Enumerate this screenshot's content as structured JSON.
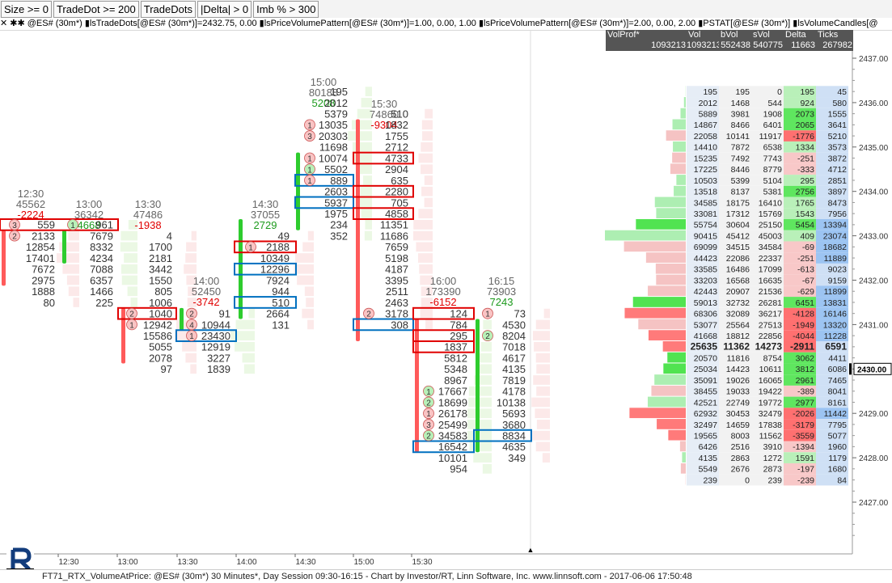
{
  "toolbar": {
    "items": [
      "Size >= 0",
      "TradeDot >= 200",
      "TradeDots",
      "|Delta| > 0",
      "Imb % > 300"
    ]
  },
  "title": "✕  ✱✱ @ES# (30m*) ▮lsTradeDots[@ES# (30m*)]=2432.75, 0.00 ▮lsPriceVolumePattern[@ES# (30m*)]=1.00, 0.00, 1.00 ▮lsPriceVolumePattern[@ES# (30m*)]=2.00, 0.00, 2.00 ▮PSTAT[@ES# (30m*)] ▮lsVolumeCandles[@",
  "footer": "FT71_RTX_VolumeAtPrice: @ES# (30m*) 30 Minutes*, Day Session 09:30-16:15 - Chart by Investor/RT, Linn Software, Inc. www.linnsoft.com - 2017-06-06 17:50:48",
  "volume_profile": {
    "summary_headers": [
      "VolProf*",
      "Vol",
      "bVol",
      "sVol",
      "Delta",
      "Ticks"
    ],
    "summary_values": [
      "1093213",
      "1093213",
      "552438",
      "540775",
      "11663",
      "267982"
    ],
    "rows": [
      {
        "price": 2436.25,
        "vp": 195,
        "vol": 195,
        "bvol": 0,
        "svol": 195,
        "delta": 195,
        "ticks": 45
      },
      {
        "price": 2436.0,
        "vp": 2012,
        "vol": 1468,
        "bvol": 544,
        "svol": 924,
        "delta": 924,
        "ticks": 580
      },
      {
        "price": 2435.75,
        "vp": 5889,
        "vol": 3981,
        "bvol": 1908,
        "svol": 2073,
        "delta": 2073,
        "ticks": 1555
      },
      {
        "price": 2435.5,
        "vp": 14867,
        "vol": 8466,
        "bvol": 6401,
        "svol": 2065,
        "delta": 2065,
        "ticks": 3641
      },
      {
        "price": 2435.25,
        "vp": 22058,
        "vol": 10141,
        "bvol": 11917,
        "svol": -1776,
        "delta": -1776,
        "ticks": 5210
      },
      {
        "price": 2435.0,
        "vp": 14410,
        "vol": 7872,
        "bvol": 6538,
        "svol": 1334,
        "delta": 1334,
        "ticks": 3573
      },
      {
        "price": 2434.75,
        "vp": 15235,
        "vol": 7492,
        "bvol": 7743,
        "svol": -251,
        "delta": -251,
        "ticks": 3872
      },
      {
        "price": 2434.5,
        "vp": 17225,
        "vol": 8446,
        "bvol": 8779,
        "svol": -333,
        "delta": -333,
        "ticks": 4712
      },
      {
        "price": 2434.25,
        "vp": 10503,
        "vol": 5399,
        "bvol": 5104,
        "svol": 295,
        "delta": 295,
        "ticks": 2851
      },
      {
        "price": 2434.0,
        "vp": 13518,
        "vol": 8137,
        "bvol": 5381,
        "svol": 2756,
        "delta": 2756,
        "ticks": 3897
      },
      {
        "price": 2433.75,
        "vp": 34585,
        "vol": 18175,
        "bvol": 16410,
        "svol": 1765,
        "delta": 1765,
        "ticks": 8473
      },
      {
        "price": 2433.5,
        "vp": 33081,
        "vol": 17312,
        "bvol": 15769,
        "svol": 1543,
        "delta": 1543,
        "ticks": 7956
      },
      {
        "price": 2433.25,
        "vp": 55754,
        "vol": 30604,
        "bvol": 25150,
        "svol": 5454,
        "delta": 5454,
        "ticks": 13394
      },
      {
        "price": 2433.0,
        "vp": 90415,
        "vol": 45412,
        "bvol": 45003,
        "svol": 409,
        "delta": 409,
        "ticks": 23074
      },
      {
        "price": 2432.75,
        "vp": 69099,
        "vol": 34515,
        "bvol": 34584,
        "svol": -69,
        "delta": -69,
        "ticks": 18682
      },
      {
        "price": 2432.5,
        "vp": 44423,
        "vol": 22086,
        "bvol": 22337,
        "svol": -251,
        "delta": -251,
        "ticks": 11889
      },
      {
        "price": 2432.25,
        "vp": 33585,
        "vol": 16486,
        "bvol": 17099,
        "svol": -613,
        "delta": -613,
        "ticks": 9023
      },
      {
        "price": 2432.0,
        "vp": 33203,
        "vol": 16568,
        "bvol": 16635,
        "svol": -67,
        "delta": -67,
        "ticks": 9159
      },
      {
        "price": 2431.75,
        "vp": 42443,
        "vol": 20907,
        "bvol": 21536,
        "svol": -629,
        "delta": -629,
        "ticks": 11899
      },
      {
        "price": 2431.5,
        "vp": 59013,
        "vol": 32732,
        "bvol": 26281,
        "svol": 6451,
        "delta": 6451,
        "ticks": 13831
      },
      {
        "price": 2431.25,
        "vp": 68306,
        "vol": 32089,
        "bvol": 36217,
        "svol": -4128,
        "delta": -4128,
        "ticks": 16146
      },
      {
        "price": 2431.0,
        "vp": 53077,
        "vol": 25564,
        "bvol": 27513,
        "svol": -1949,
        "delta": -1949,
        "ticks": 13320
      },
      {
        "price": 2430.75,
        "vp": 41668,
        "vol": 18812,
        "bvol": 22856,
        "svol": -4044,
        "delta": -4044,
        "ticks": 11228
      },
      {
        "price": 2430.5,
        "vp": 25635,
        "vol": 11362,
        "bvol": 14273,
        "svol": -2911,
        "delta": -2911,
        "ticks": 6591
      },
      {
        "price": 2430.25,
        "vp": 20570,
        "vol": 11816,
        "bvol": 8754,
        "svol": 3062,
        "delta": 3062,
        "ticks": 4411
      },
      {
        "price": 2430.0,
        "vp": 25034,
        "vol": 14423,
        "bvol": 10611,
        "svol": 3812,
        "delta": 3812,
        "ticks": 6086
      },
      {
        "price": 2429.75,
        "vp": 35091,
        "vol": 19026,
        "bvol": 16065,
        "svol": 2961,
        "delta": 2961,
        "ticks": 7465
      },
      {
        "price": 2429.5,
        "vp": 38455,
        "vol": 19033,
        "bvol": 19422,
        "svol": -389,
        "delta": -389,
        "ticks": 8041
      },
      {
        "price": 2429.25,
        "vp": 42521,
        "vol": 22749,
        "bvol": 19772,
        "svol": 2977,
        "delta": 2977,
        "ticks": 8161
      },
      {
        "price": 2429.0,
        "vp": 62932,
        "vol": 30453,
        "bvol": 32479,
        "svol": -2026,
        "delta": -2026,
        "ticks": 11442
      },
      {
        "price": 2428.75,
        "vp": 32497,
        "vol": 14659,
        "bvol": 17838,
        "svol": -3179,
        "delta": -3179,
        "ticks": 7795
      },
      {
        "price": 2428.5,
        "vp": 19565,
        "vol": 8003,
        "bvol": 11562,
        "svol": -3559,
        "delta": -3559,
        "ticks": 5077
      },
      {
        "price": 2428.25,
        "vp": 6426,
        "vol": 2516,
        "bvol": 3910,
        "svol": -1394,
        "delta": -1394,
        "ticks": 1960
      },
      {
        "price": 2428.0,
        "vp": 4135,
        "vol": 2863,
        "bvol": 1272,
        "svol": 1591,
        "delta": 1591,
        "ticks": 1179
      },
      {
        "price": 2427.75,
        "vp": 5549,
        "vol": 2676,
        "bvol": 2873,
        "svol": -197,
        "delta": -197,
        "ticks": 1680
      },
      {
        "price": 2427.5,
        "vp": 239,
        "vol": 0,
        "bvol": 239,
        "svol": -239,
        "delta": -239,
        "ticks": 84
      }
    ]
  },
  "price_axis": {
    "labels": [
      "2437.00",
      "2436.00",
      "2435.00",
      "2434.00",
      "2433.00",
      "2432.00",
      "2431.00",
      "2430.00",
      "2429.00",
      "2428.00",
      "2427.00"
    ],
    "current": "2430.00"
  },
  "time_axis": {
    "labels": [
      "12:30",
      "13:00",
      "13:30",
      "14:00",
      "14:30",
      "15:00",
      "15:30"
    ]
  },
  "bars": [
    {
      "time": "12:30",
      "volume": "45562",
      "delta": "-2224",
      "delta_color": "#e00000",
      "values": [
        "559",
        "2133",
        "12854",
        "17401",
        "7672",
        "2975",
        "1888",
        "80"
      ]
    },
    {
      "time": "13:00",
      "volume": "36342",
      "delta": "4668",
      "delta_color": "#1c9a1c",
      "values": [
        "961",
        "7679",
        "8332",
        "4234",
        "7088",
        "6357",
        "1466",
        "225"
      ]
    },
    {
      "time": "13:30",
      "volume": "47486",
      "delta": "-1938",
      "delta_color": "#e00000",
      "values": [
        "4",
        "1700",
        "2181",
        "3442",
        "1550",
        "805",
        "1006",
        "1040",
        "12942",
        "15586",
        "5055",
        "2078",
        "97"
      ]
    },
    {
      "time": "14:00",
      "volume": "52450",
      "delta": "-3742",
      "delta_color": "#e00000",
      "values": [
        "91",
        "10944",
        "23430",
        "12919",
        "3227",
        "1839"
      ]
    },
    {
      "time": "14:30",
      "volume": "37055",
      "delta": "2729",
      "delta_color": "#1c9a1c",
      "values": [
        "49",
        "2188",
        "10349",
        "12296",
        "7924",
        "944",
        "510",
        "2664",
        "131"
      ]
    },
    {
      "time": "15:00",
      "volume": "80188",
      "delta": "5208",
      "delta_color": "#1c9a1c",
      "values": [
        "195",
        "2012",
        "5379",
        "13035",
        "20303",
        "11698",
        "10074",
        "5502",
        "889",
        "2603",
        "5937",
        "1975",
        "234",
        "352"
      ]
    },
    {
      "time": "15:30",
      "volume": "74860",
      "delta": "-9304",
      "delta_color": "#e00000",
      "values": [
        "510",
        "1832",
        "1755",
        "2712",
        "4733",
        "2904",
        "635",
        "2280",
        "705",
        "4858",
        "11351",
        "11686",
        "7659",
        "5198",
        "4187",
        "3395",
        "2511",
        "2463",
        "3178",
        "308"
      ]
    },
    {
      "time": "16:00",
      "volume": "173390",
      "delta": "-6152",
      "delta_color": "#e00000",
      "values": [
        "124",
        "784",
        "295",
        "1837",
        "5812",
        "5348",
        "8967",
        "17667",
        "18699",
        "26178",
        "25499",
        "34583",
        "16542",
        "10101",
        "954"
      ]
    },
    {
      "time": "16:15",
      "volume": "73903",
      "delta": "7243",
      "delta_color": "#1c9a1c",
      "values": [
        "73",
        "4530",
        "8204",
        "7018",
        "4617",
        "4135",
        "7819",
        "4178",
        "10138",
        "5693",
        "3680",
        "8834",
        "4635",
        "349"
      ]
    }
  ],
  "trade_dots": [
    "3",
    "2",
    "1",
    "2",
    "1",
    "2",
    "4",
    "1",
    "1",
    "1",
    "3",
    "1",
    "1",
    "1",
    "2",
    "1",
    "2",
    "1",
    "3",
    "2",
    "1",
    "2"
  ],
  "colors": {
    "buy": "#2ecc2e",
    "sell": "#ff5a5a",
    "imbalance_sell": "#e00000",
    "imbalance_buy": "#0070c0",
    "dot": "#f9c4c4",
    "dot_green": "#b8f0b8"
  }
}
